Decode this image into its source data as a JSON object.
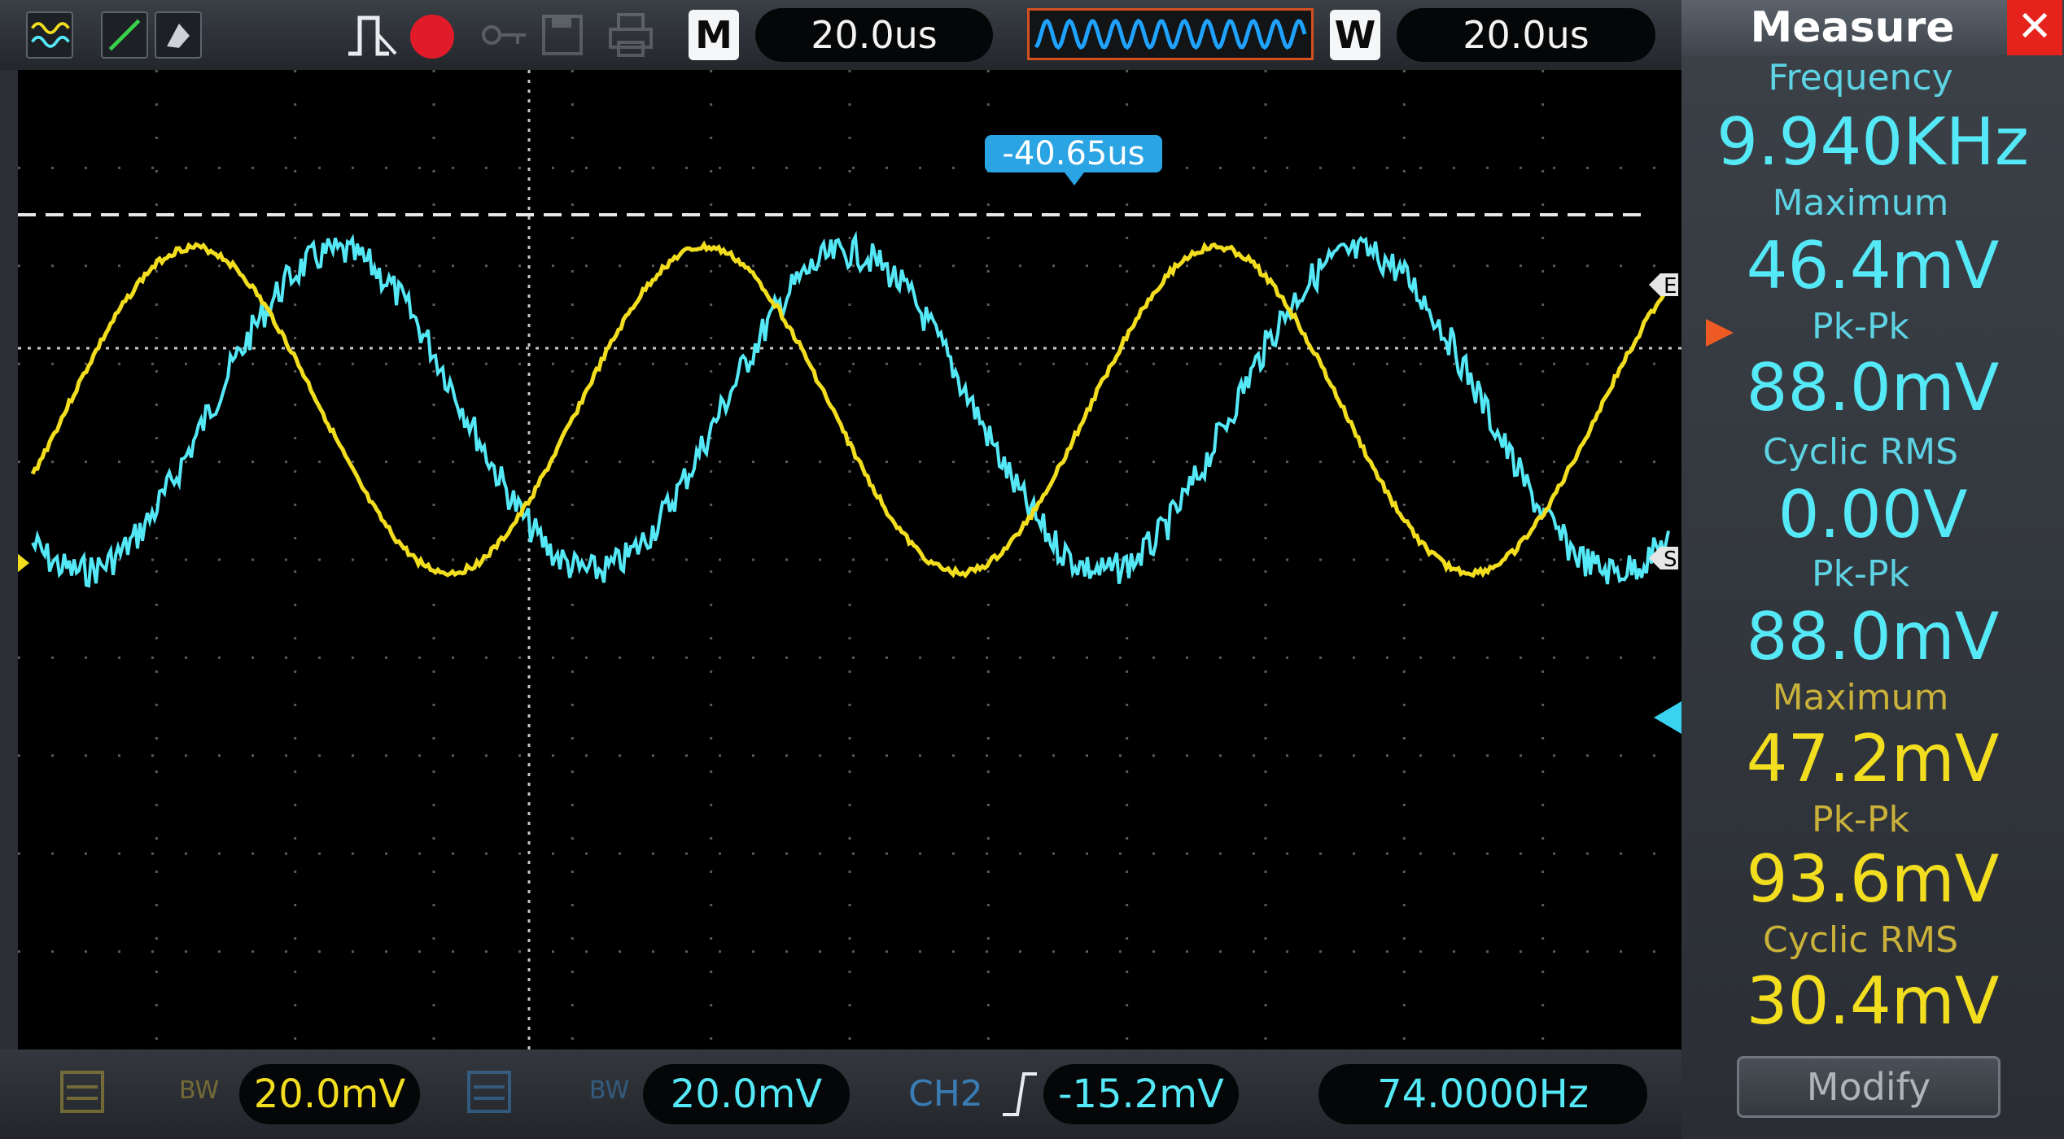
{
  "top_bar": {
    "timebase_main_label": "M",
    "timebase_main_value": "20.0us",
    "window_label": "W",
    "window_value": "20.0us",
    "trigger_offset": "-40.65us"
  },
  "screen": {
    "ch1_color": "#f2de1f",
    "ch2_color": "#55e8f6",
    "marker_e": "E",
    "marker_s": "S"
  },
  "measure": {
    "title": "Measure",
    "close": "✕",
    "items": [
      {
        "label": "Frequency",
        "value": "9.940KHz",
        "channel": "ch2"
      },
      {
        "label": "Maximum",
        "value": "46.4mV",
        "channel": "ch2"
      },
      {
        "label": "Pk-Pk",
        "value": "88.0mV",
        "channel": "ch2",
        "selected": true
      },
      {
        "label": "Cyclic RMS",
        "value": "0.00V",
        "channel": "ch2"
      },
      {
        "label": "Pk-Pk",
        "value": "88.0mV",
        "channel": "ch2"
      },
      {
        "label": "Maximum",
        "value": "47.2mV",
        "channel": "ch1"
      },
      {
        "label": "Pk-Pk",
        "value": "93.6mV",
        "channel": "ch1"
      },
      {
        "label": "Cyclic RMS",
        "value": "30.4mV",
        "channel": "ch1"
      }
    ],
    "modify": "Modify"
  },
  "bottom_bar": {
    "ch1_scale": "20.0mV",
    "ch2_scale": "20.0mV",
    "trigger_source": "CH2",
    "trigger_level": "-15.2mV",
    "trigger_freq": "74.0000Hz"
  }
}
